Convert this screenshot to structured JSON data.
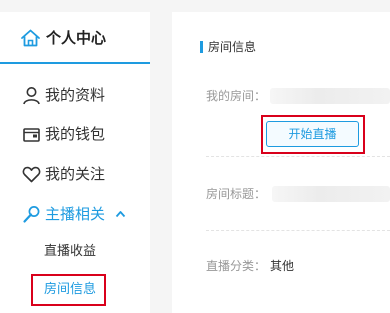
{
  "sidebar": {
    "header": {
      "title": "个人中心",
      "icon": "home-icon"
    },
    "items": [
      {
        "label": "我的资料",
        "icon": "user-icon"
      },
      {
        "label": "我的钱包",
        "icon": "wallet-icon"
      },
      {
        "label": "我的关注",
        "icon": "heart-icon"
      },
      {
        "label": "主播相关",
        "icon": "microphone-icon",
        "expanded": true
      }
    ],
    "sub_items": [
      {
        "label": "直播收益"
      },
      {
        "label": "房间信息",
        "selected": true
      }
    ]
  },
  "main": {
    "section_title": "房间信息",
    "room_label": "我的房间：",
    "start_button": "开始直播",
    "room_title_label": "房间标题：",
    "category_label": "直播分类：",
    "category_value": "其他"
  },
  "colors": {
    "accent": "#1e9be0",
    "highlight": "#d9001b"
  }
}
